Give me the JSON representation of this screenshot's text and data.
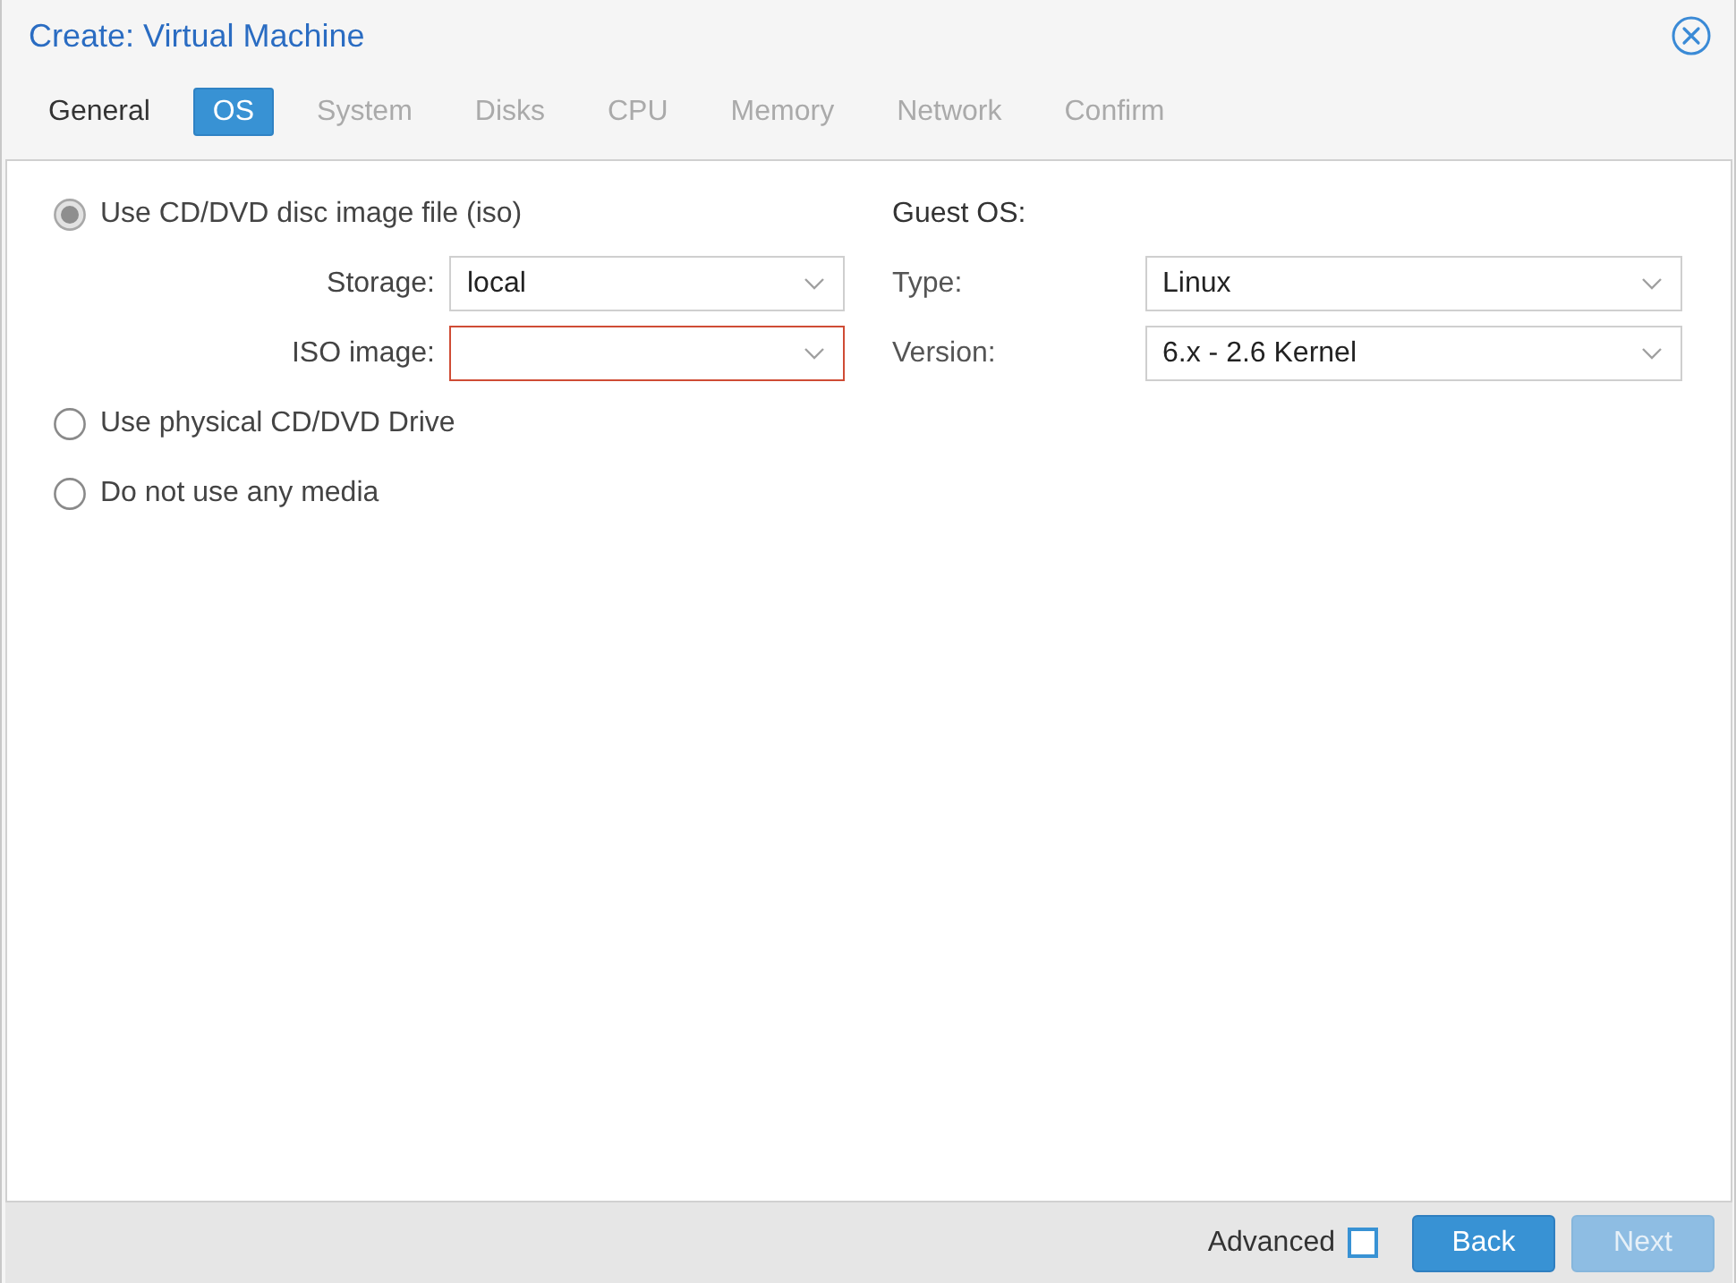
{
  "window": {
    "title": "Create: Virtual Machine"
  },
  "tabs": [
    {
      "label": "General",
      "selected": false,
      "disabled": false
    },
    {
      "label": "OS",
      "selected": true,
      "disabled": false
    },
    {
      "label": "System",
      "selected": false,
      "disabled": true
    },
    {
      "label": "Disks",
      "selected": false,
      "disabled": true
    },
    {
      "label": "CPU",
      "selected": false,
      "disabled": true
    },
    {
      "label": "Memory",
      "selected": false,
      "disabled": true
    },
    {
      "label": "Network",
      "selected": false,
      "disabled": true
    },
    {
      "label": "Confirm",
      "selected": false,
      "disabled": true
    }
  ],
  "media": {
    "options": [
      {
        "label": "Use CD/DVD disc image file (iso)",
        "selected": true,
        "fields": [
          {
            "label": "Storage:",
            "value": "local",
            "invalid": false
          },
          {
            "label": "ISO image:",
            "invalid": true
          }
        ]
      },
      {
        "label": "Use physical CD/DVD Drive",
        "selected": false
      },
      {
        "label": "Do not use any media",
        "selected": false
      }
    ]
  },
  "guest_os": {
    "heading": "Guest OS:",
    "fields": [
      {
        "label": "Type:",
        "value": "Linux"
      },
      {
        "label": "Version:",
        "value": "6.x - 2.6 Kernel"
      }
    ]
  },
  "footer": {
    "advanced": {
      "label": "Advanced",
      "checked": false
    },
    "buttons": [
      {
        "label": "Back",
        "disabled": false
      },
      {
        "label": "Next",
        "disabled": true
      }
    ]
  }
}
